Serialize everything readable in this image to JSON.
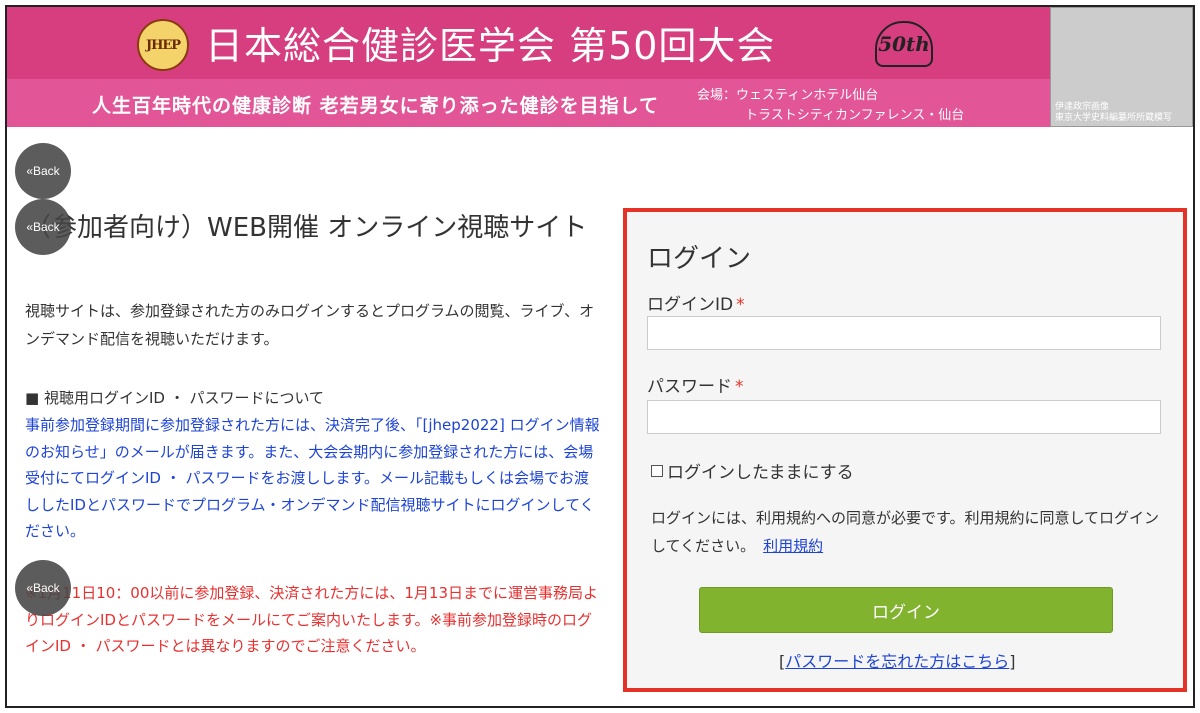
{
  "banner": {
    "logo_text": "JHEP",
    "title": "日本総合健診医学会 第50回大会",
    "anniversary": "50th",
    "subtitle": "人生百年時代の健康診断 老若男女に寄り添った健診を目指して",
    "venue_line1": "会場：ウェスティンホテル仙台",
    "venue_line2": "トラストシティカンファレンス・仙台",
    "portrait_caption": "伊達政宗画像\n東京大学史料編纂所所蔵模写"
  },
  "back_label": "«Back",
  "page": {
    "title": "（参加者向け）WEB開催 オンライン視聴サイト",
    "intro": "視聴サイトは、参加登録された方のみログインするとプログラムの閲覧、ライブ、オンデマンド配信を視聴いただけます。",
    "section_heading": "■ 視聴用ログインID ・ パスワードについて",
    "blue_text": "事前参加登録期間に参加登録された方には、決済完了後、「[jhep2022] ログイン情報のお知らせ」のメールが届きます。また、大会会期内に参加登録された方には、会場受付にてログインID ・ パスワードをお渡しします。メール記載もしくは会場でお渡ししたIDとパスワードでプログラム・オンデマンド配信視聴サイトにログインしてください。",
    "red_text": "※1月11日10：00以前に参加登録、決済された方には、1月13日までに運営事務局よりログインIDとパスワードをメールにてご案内いたします。※事前参加登録時のログインID ・ パスワードとは異なりますのでご注意ください。"
  },
  "login": {
    "heading": "ログイン",
    "id_label": "ログインID",
    "password_label": "パスワード",
    "required_mark": "*",
    "id_value": "",
    "password_value": "",
    "remember_label": "ログインしたままにする",
    "terms_text": "ログインには、利用規約への同意が必要です。利用規約に同意してログインしてください。",
    "terms_link": "利用規約",
    "submit_label": "ログイン",
    "forgot_prefix": "[",
    "forgot_link": "パスワードを忘れた方はこちら",
    "forgot_suffix": "]"
  },
  "colors": {
    "banner_top": "#d63e7f",
    "banner_bottom": "#e25597",
    "panel_border": "#e53227",
    "login_button": "#82b32f",
    "blue_text": "#1e44d6",
    "red_text": "#e8302f"
  }
}
